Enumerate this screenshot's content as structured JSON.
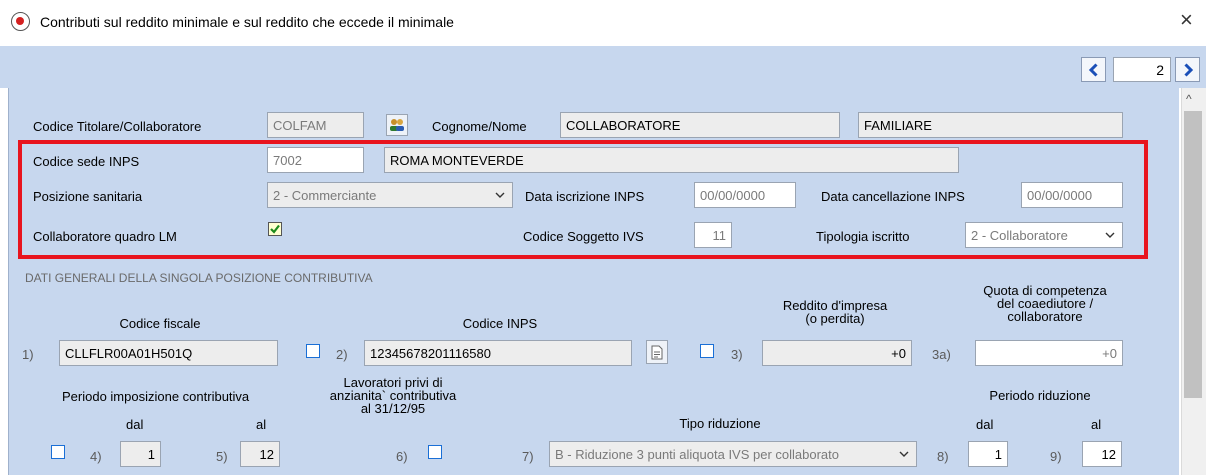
{
  "window": {
    "title": "Contributi sul reddito minimale e sul reddito che eccede il minimale",
    "close_glyph": "×",
    "icon": "app-record-icon"
  },
  "nav": {
    "page": "2",
    "prev_icon": "chevron-left-icon",
    "next_icon": "chevron-right-icon"
  },
  "titolare": {
    "codice_label": "Codice Titolare/Collaboratore",
    "codice_value": "COLFAM",
    "lookup_icon": "users-icon",
    "cognome_label": "Cognome/Nome",
    "cognome_value": "COLLABORATORE",
    "nome_value": "FAMILIARE"
  },
  "inps": {
    "sede_label": "Codice sede INPS",
    "sede_code": "7002",
    "sede_name": "ROMA MONTEVERDE",
    "posizione_label": "Posizione sanitaria",
    "posizione_value": "2 - Commerciante",
    "iscrizione_label": "Data iscrizione INPS",
    "iscrizione_value": "00/00/0000",
    "cancellazione_label": "Data cancellazione INPS",
    "cancellazione_value": "00/00/0000",
    "quadro_label": "Collaboratore quadro LM",
    "quadro_checked": true,
    "ivs_label": "Codice Soggetto IVS",
    "ivs_value": "11",
    "tipologia_label": "Tipologia iscritto",
    "tipologia_value": "2 - Collaboratore"
  },
  "dati": {
    "section_title": "DATI GENERALI DELLA SINGOLA POSIZIONE CONTRIBUTIVA",
    "cf_header": "Codice fiscale",
    "inps_header": "Codice INPS",
    "reddito_header": "Reddito d'impresa\n(o perdita)",
    "quota_header": "Quota di competenza\ndel coaediutore /\ncollaboratore",
    "n1": "1)",
    "cf_value": "CLLFLR00A01H501Q",
    "n2": "2)",
    "inps_value": "12345678201116580",
    "n3": "3)",
    "reddito_value": "+0",
    "n3a": "3a)",
    "quota_value": "+0",
    "periodo_header": "Periodo imposizione contributiva",
    "lavoratori_header": "Lavoratori privi di\nanzianita` contributiva\nal 31/12/95",
    "tipo_rid_header": "Tipo riduzione",
    "periodo_rid_header": "Periodo riduzione",
    "dal_label": "dal",
    "al_label": "al",
    "rid_dal_label": "dal",
    "rid_al_label": "al",
    "n4": "4)",
    "dal_value": "1",
    "n5": "5)",
    "al_value": "12",
    "n6": "6)",
    "n7": "7)",
    "tipo_rid_value": "B - Riduzione 3 punti aliquota IVS per collaborato",
    "n8": "8)",
    "rid_dal_value": "1",
    "n9": "9)",
    "rid_al_value": "12"
  },
  "scrollbar": {
    "up_glyph": "^"
  },
  "colors": {
    "panel": "#c7d7ee",
    "highlight": "#e8141e",
    "accent": "#1a6fd6"
  }
}
